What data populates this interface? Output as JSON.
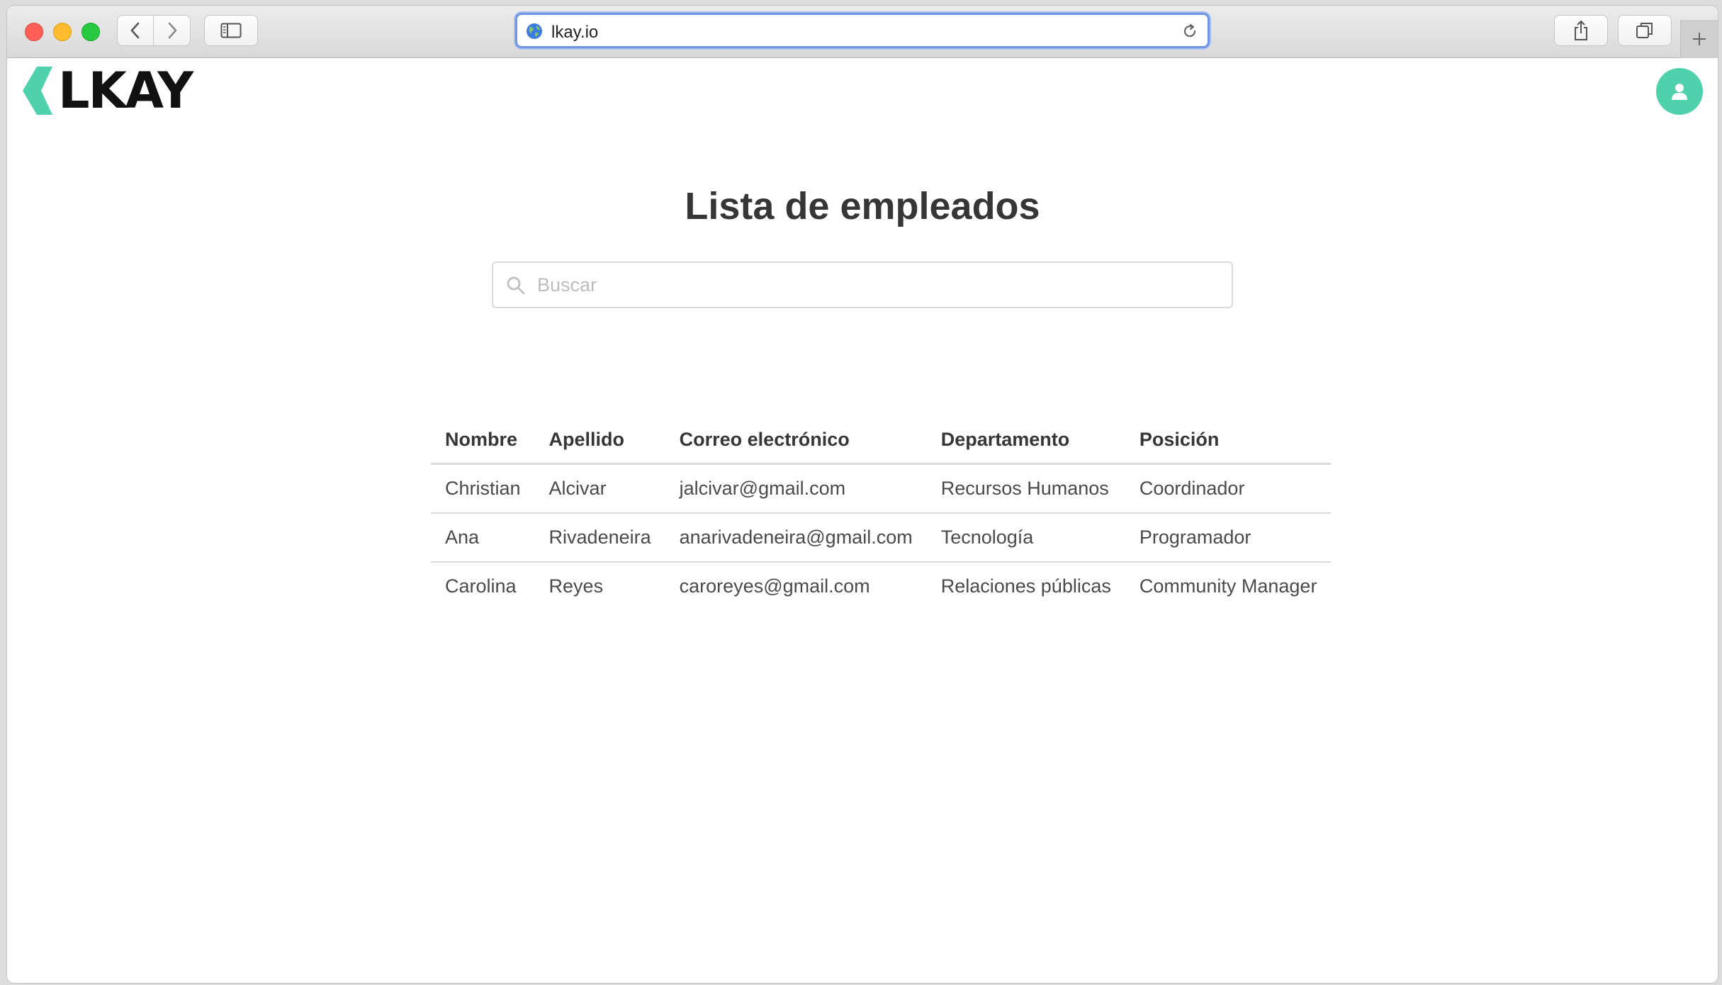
{
  "browser": {
    "url": "lkay.io",
    "buttons": [
      "back",
      "forward",
      "sidebar",
      "share",
      "tabs",
      "new-tab"
    ]
  },
  "brand": {
    "name": "LKAY",
    "accent": "#4fd1ab"
  },
  "page": {
    "title": "Lista de empleados",
    "search": {
      "placeholder": "Buscar",
      "value": ""
    }
  },
  "table": {
    "headers": [
      "Nombre",
      "Apellido",
      "Correo electrónico",
      "Departamento",
      "Posición"
    ],
    "rows": [
      [
        "Christian",
        "Alcivar",
        "jalcivar@gmail.com",
        "Recursos Humanos",
        "Coordinador"
      ],
      [
        "Ana",
        "Rivadeneira",
        "anarivadeneira@gmail.com",
        "Tecnología",
        "Programador"
      ],
      [
        "Carolina",
        "Reyes",
        "caroreyes@gmail.com",
        "Relaciones públicas",
        "Community Manager"
      ]
    ]
  }
}
